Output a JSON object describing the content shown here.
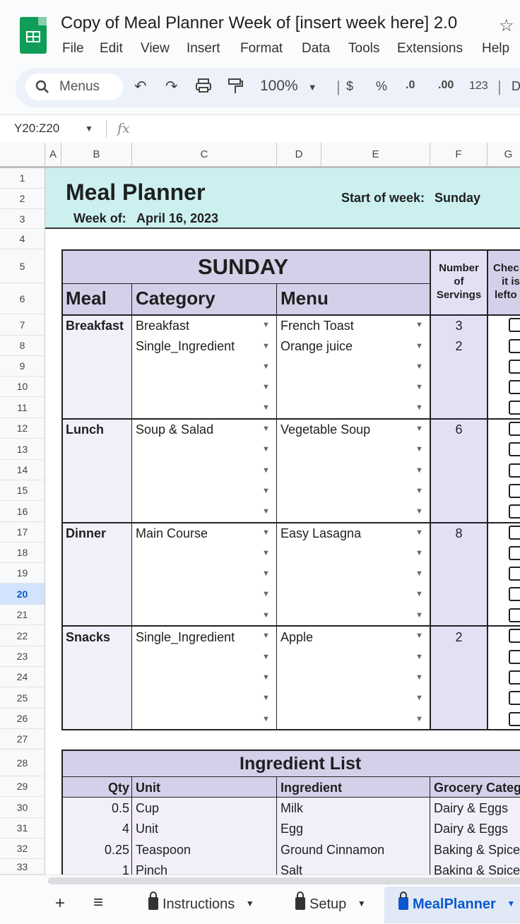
{
  "header": {
    "doc_title": "Copy of Meal Planner Week of [insert week here] 2.0",
    "menus": [
      "File",
      "Edit",
      "View",
      "Insert",
      "Format",
      "Data",
      "Tools",
      "Extensions",
      "Help"
    ],
    "search_placeholder": "Menus",
    "zoom": "100%",
    "fmt_currency": "$",
    "fmt_percent": "%",
    "fmt_dec_less": ".0",
    "fmt_dec_more": ".00",
    "fmt_number": "123",
    "fmt_extra": "D"
  },
  "formula_bar": {
    "name_box": "Y20:Z20",
    "fx": "fx",
    "value": ""
  },
  "columns": [
    "A",
    "B",
    "C",
    "D",
    "E",
    "F",
    "G"
  ],
  "rows": [
    "1",
    "2",
    "3",
    "4",
    "5",
    "6",
    "7",
    "8",
    "9",
    "10",
    "11",
    "12",
    "13",
    "14",
    "15",
    "16",
    "17",
    "18",
    "19",
    "20",
    "21",
    "22",
    "23",
    "24",
    "25",
    "26",
    "27",
    "28",
    "29",
    "30",
    "31",
    "32",
    "33"
  ],
  "selected_row": "20",
  "planner": {
    "title": "Meal Planner",
    "week_of_label": "Week of:",
    "week_of_value": "April 16, 2023",
    "start_label": "Start of week:",
    "start_value": "Sunday",
    "day": "SUNDAY",
    "col_meal": "Meal",
    "col_category": "Category",
    "col_menu": "Menu",
    "col_servings": [
      "Number",
      "of",
      "Servings"
    ],
    "col_check": [
      "Chec",
      "it is",
      "lefto"
    ],
    "meals": [
      {
        "meal": "Breakfast",
        "items": [
          {
            "category": "Breakfast",
            "menu": "French Toast",
            "servings": "3"
          },
          {
            "category": "Single_Ingredient",
            "menu": "Orange juice",
            "servings": "2"
          }
        ]
      },
      {
        "meal": "Lunch",
        "items": [
          {
            "category": "Soup & Salad",
            "menu": "Vegetable Soup",
            "servings": "6"
          }
        ]
      },
      {
        "meal": "Dinner",
        "items": [
          {
            "category": "Main Course",
            "menu": "Easy Lasagna",
            "servings": "8"
          }
        ]
      },
      {
        "meal": "Snacks",
        "items": [
          {
            "category": "Single_Ingredient",
            "menu": "Apple",
            "servings": "2"
          }
        ]
      }
    ]
  },
  "ingredients": {
    "title": "Ingredient List",
    "headers": [
      "Qty",
      "Unit",
      "Ingredient",
      "Grocery Categ"
    ],
    "rows": [
      [
        "0.5",
        "Cup",
        "Milk",
        "Dairy & Eggs"
      ],
      [
        "4",
        "Unit",
        "Egg",
        "Dairy & Eggs"
      ],
      [
        "0.25",
        "Teaspoon",
        "Ground Cinnamon",
        "Baking & Spice"
      ],
      [
        "1",
        "Pinch",
        "Salt",
        "Baking & Spice"
      ]
    ]
  },
  "sheet_tabs": [
    {
      "label": "Instructions",
      "locked": true,
      "active": false
    },
    {
      "label": "Setup",
      "locked": true,
      "active": false
    },
    {
      "label": "MealPlanner",
      "locked": true,
      "active": true
    }
  ],
  "colors": {
    "accent": "#0b57d0",
    "planner_header": "#ccf0f0",
    "table_header": "#d5d0ea",
    "table_body": "#f2effa",
    "servings_col": "#e4e0f4"
  }
}
